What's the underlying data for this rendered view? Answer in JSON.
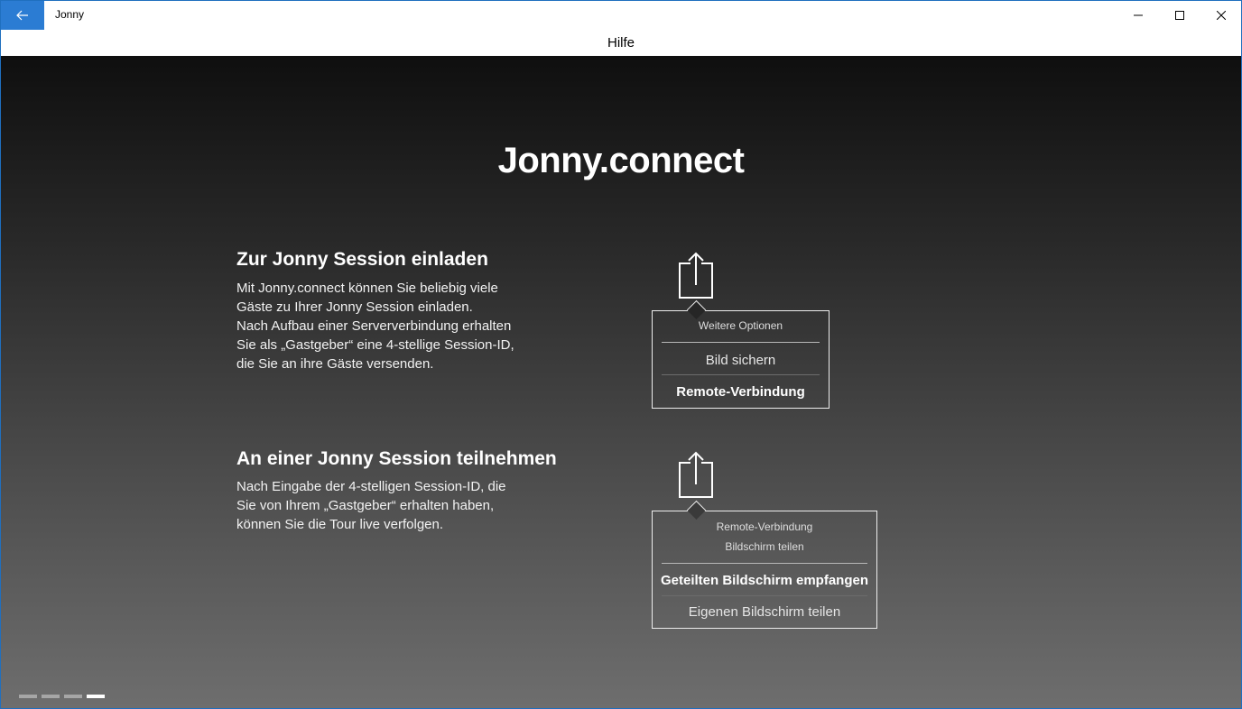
{
  "app": {
    "title": "Jonny"
  },
  "header": {
    "title": "Hilfe"
  },
  "main": {
    "title": "Jonny.connect"
  },
  "section1": {
    "title": "Zur Jonny Session einladen",
    "lines": [
      "Mit Jonny.connect können Sie beliebig viele",
      "Gäste zu Ihrer Jonny Session einladen.",
      "Nach Aufbau einer Serververbindung erhalten",
      "Sie als „Gastgeber“ eine 4-stellige Session-ID,",
      "die Sie an ihre Gäste versenden."
    ],
    "menu": {
      "header": "Weitere Optionen",
      "items": [
        "Bild sichern",
        "Remote-Verbindung"
      ]
    }
  },
  "section2": {
    "title": "An einer Jonny Session teilnehmen",
    "lines": [
      "Nach Eingabe der 4-stelligen Session-ID, die",
      "Sie von Ihrem „Gastgeber“ erhalten haben,",
      "können Sie die Tour live verfolgen."
    ],
    "menu": {
      "header_lines": [
        "Remote-Verbindung",
        "Bildschirm teilen"
      ],
      "items": [
        "Geteilten Bildschirm empfangen",
        "Eigenen Bildschirm teilen"
      ]
    }
  },
  "icons": {
    "back": "back-arrow-icon",
    "minimize": "minimize-icon",
    "maximize": "maximize-icon",
    "close": "close-icon",
    "share": "share-icon"
  },
  "pager": {
    "count": 4,
    "active_index": 3
  },
  "colors": {
    "accent": "#2b7cd3",
    "background_top": "#0f0f0f",
    "background_bottom": "#6e6e6e"
  }
}
